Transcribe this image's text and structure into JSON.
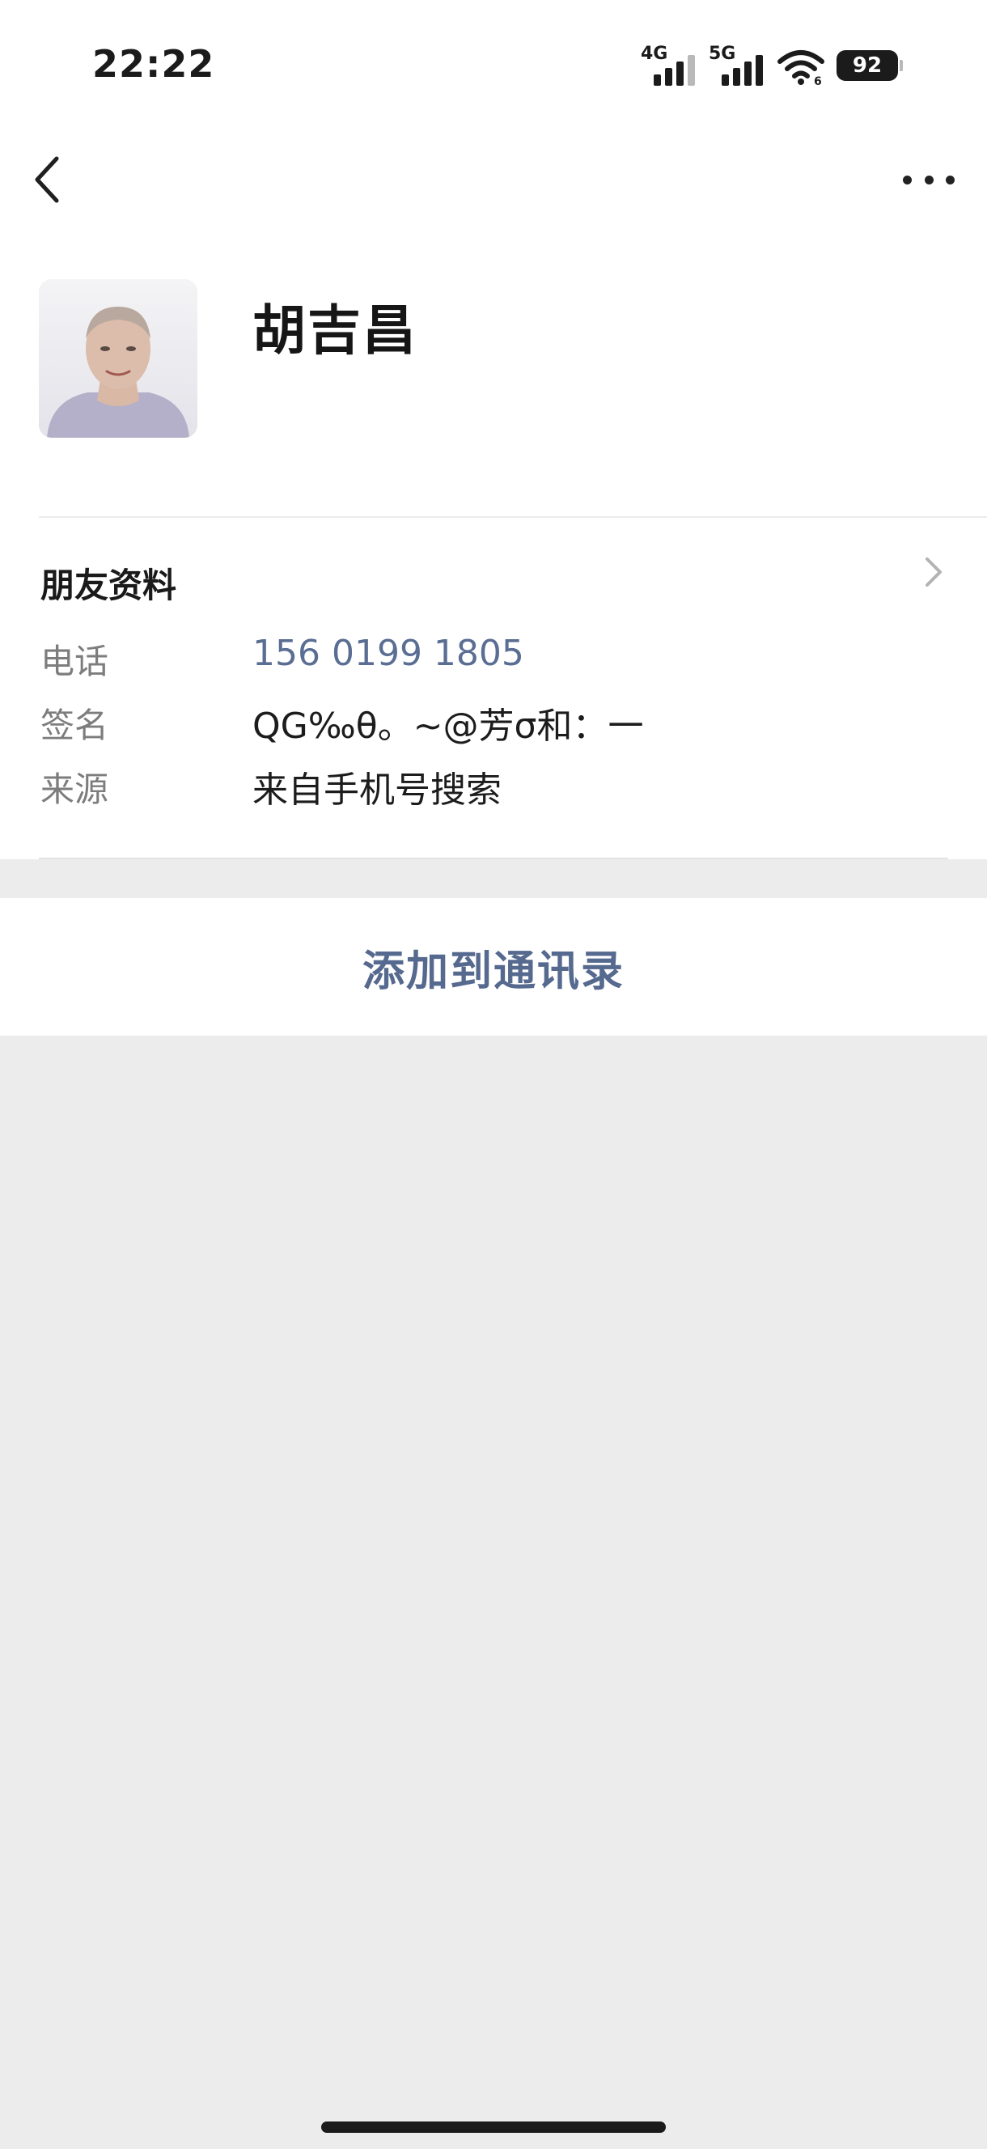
{
  "status_bar": {
    "time": "22:22",
    "network_1": "4G",
    "network_2": "5G",
    "battery_level": "92"
  },
  "nav": {
    "back_icon": "chevron-left-icon",
    "more_icon": "more-horizontal-icon"
  },
  "profile": {
    "name": "胡吉昌"
  },
  "friend_info": {
    "section_title": "朋友资料",
    "rows": [
      {
        "label": "电话",
        "value": "156 0199 1805"
      },
      {
        "label": "签名",
        "value": "QG‰θ。~@芳σ和：一"
      },
      {
        "label": "来源",
        "value": "来自手机号搜索"
      }
    ]
  },
  "actions": {
    "add_to_contacts": "添加到通讯录"
  },
  "colors": {
    "accent_link": "#56698e",
    "page_background": "#ececec",
    "panel_background": "#ffffff"
  }
}
